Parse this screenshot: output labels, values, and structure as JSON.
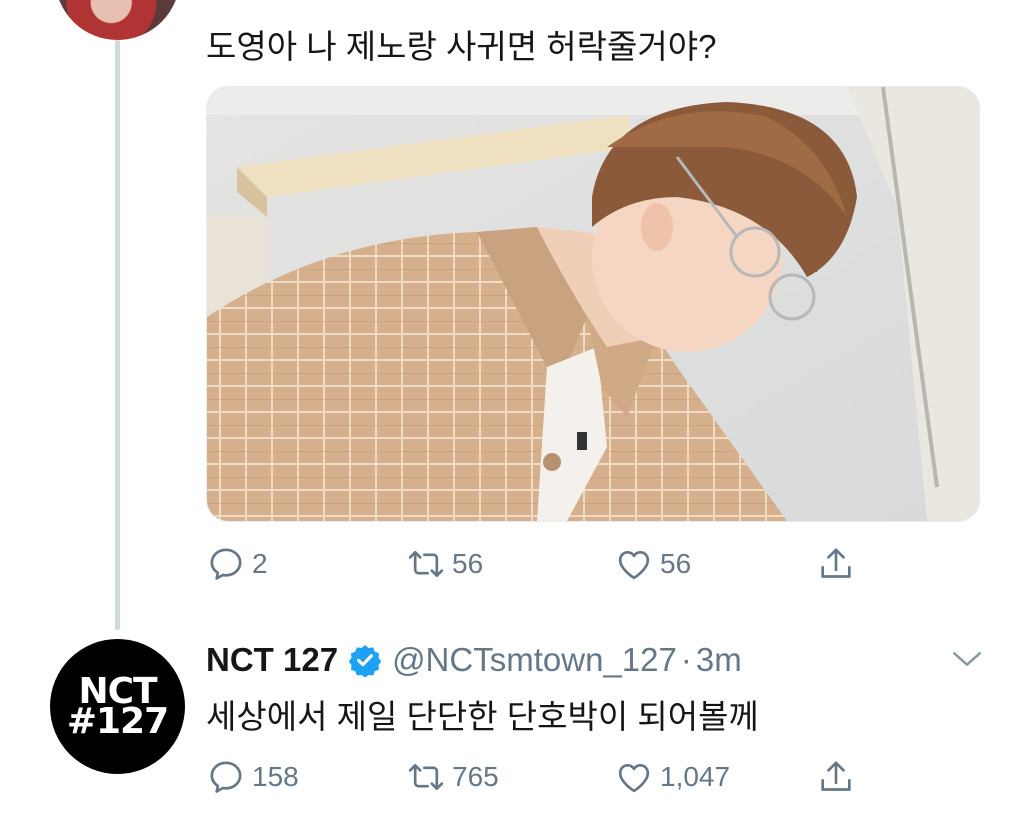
{
  "tweet1": {
    "text": "도영아 나 제노랑 사귀면 허락줄거야?",
    "replies": "2",
    "retweets": "56",
    "likes": "56"
  },
  "tweet2": {
    "display_name": "NCT 127",
    "handle": "@NCTsmtown_127",
    "separator": "·",
    "time": "3m",
    "text": "세상에서 제일 단단한 단호박이 되어볼께",
    "replies": "158",
    "retweets": "765",
    "likes": "1,047",
    "avatar_line1": "NCT",
    "avatar_line2": "#127"
  },
  "colors": {
    "text": "#14171a",
    "secondary": "#657786",
    "verified": "#1da1f2",
    "thread_line": "#cfd9de"
  },
  "icons": [
    "reply-icon",
    "retweet-icon",
    "like-icon",
    "share-icon",
    "verified-badge-icon",
    "chevron-down-icon"
  ]
}
